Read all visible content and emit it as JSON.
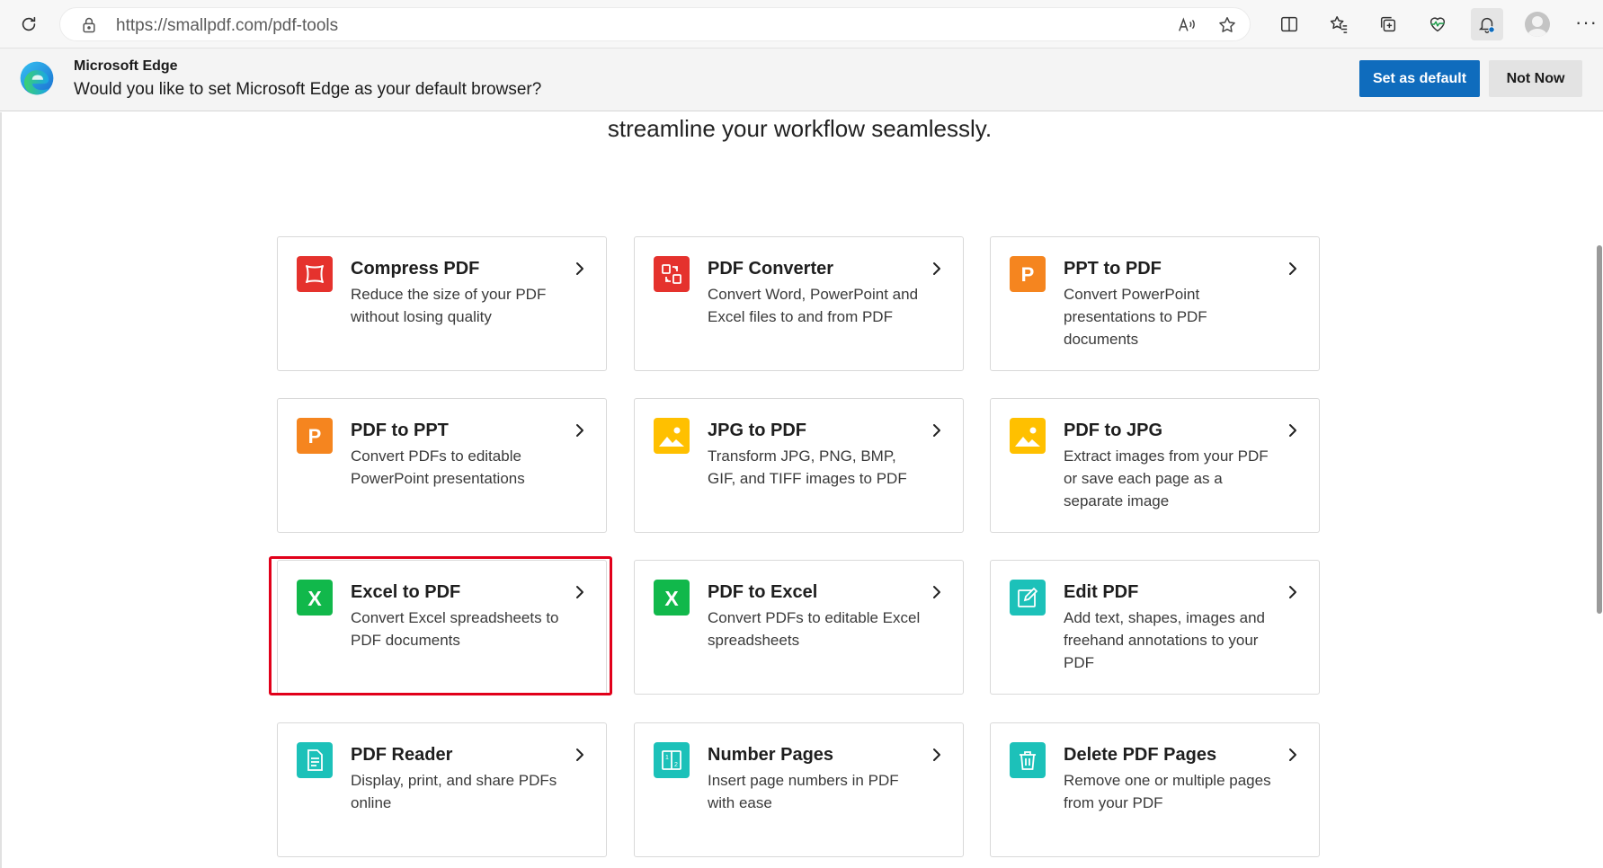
{
  "browser": {
    "url": "https://smallpdf.com/pdf-tools",
    "more_label": "···"
  },
  "infobar": {
    "title": "Microsoft Edge",
    "message": "Would you like to set Microsoft Edge as your default browser?",
    "primary_button": "Set as default",
    "secondary_button": "Not Now",
    "primary_color": "#0f6cbd"
  },
  "page": {
    "tagline": "streamline your workflow seamlessly."
  },
  "tools": [
    {
      "title": "Compress PDF",
      "desc": "Reduce the size of your PDF without losing quality",
      "icon": "compress-icon",
      "color": "#e5322d"
    },
    {
      "title": "PDF Converter",
      "desc": "Convert Word, PowerPoint and Excel files to and from PDF",
      "icon": "converter-icon",
      "color": "#e5322d"
    },
    {
      "title": "PPT to PDF",
      "desc": "Convert PowerPoint presentations to PDF documents",
      "icon": "powerpoint-icon",
      "color": "#f5851f"
    },
    {
      "title": "PDF to PPT",
      "desc": "Convert PDFs to editable PowerPoint presentations",
      "icon": "powerpoint-icon",
      "color": "#f5851f"
    },
    {
      "title": "JPG to PDF",
      "desc": "Transform JPG, PNG, BMP, GIF, and TIFF images to PDF",
      "icon": "image-icon",
      "color": "#ffc000"
    },
    {
      "title": "PDF to JPG",
      "desc": "Extract images from your PDF or save each page as a separate image",
      "icon": "image-icon",
      "color": "#ffc000"
    },
    {
      "title": "Excel to PDF",
      "desc": "Convert Excel spreadsheets to PDF documents",
      "icon": "excel-icon",
      "color": "#11b84b"
    },
    {
      "title": "PDF to Excel",
      "desc": "Convert PDFs to editable Excel spreadsheets",
      "icon": "excel-icon",
      "color": "#11b84b"
    },
    {
      "title": "Edit PDF",
      "desc": "Add text, shapes, images and freehand annotations to your PDF",
      "icon": "edit-icon",
      "color": "#1cc1b9"
    },
    {
      "title": "PDF Reader",
      "desc": "Display, print, and share PDFs online",
      "icon": "reader-icon",
      "color": "#1cc1b9"
    },
    {
      "title": "Number Pages",
      "desc": "Insert page numbers in PDF with ease",
      "icon": "number-pages-icon",
      "color": "#1cc1b9"
    },
    {
      "title": "Delete PDF Pages",
      "desc": "Remove one or multiple pages from your PDF",
      "icon": "trash-icon",
      "color": "#1cc1b9"
    }
  ],
  "highlighted_tool": "Excel to PDF",
  "highlight_color": "#e1001a"
}
